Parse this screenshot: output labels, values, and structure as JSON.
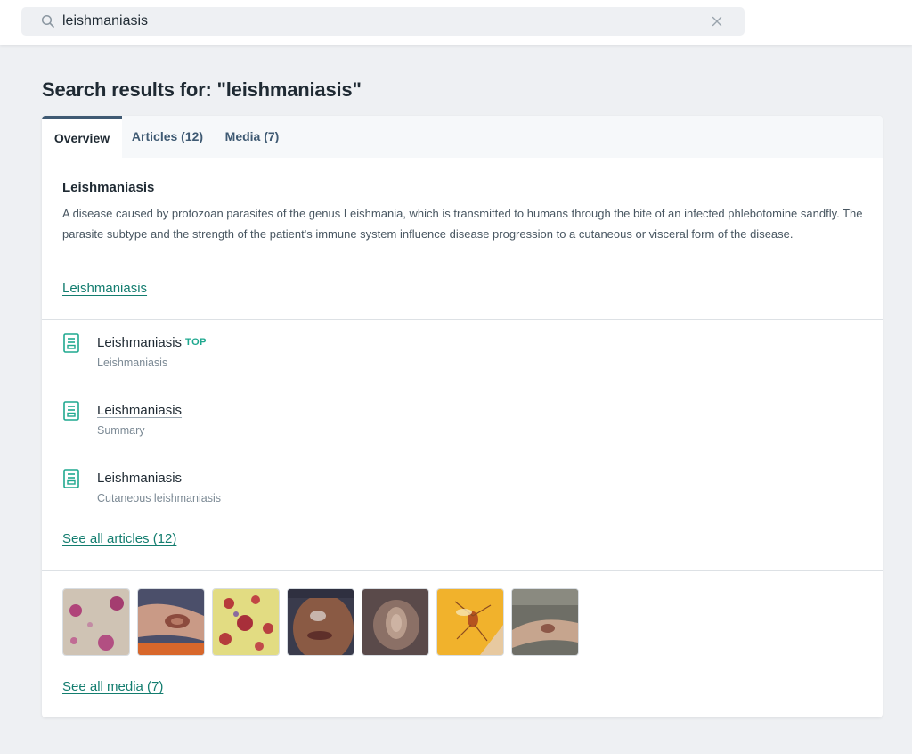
{
  "search": {
    "value": "leishmaniasis",
    "placeholder": ""
  },
  "page": {
    "title": "Search results for: \"leishmaniasis\""
  },
  "tabs": [
    {
      "label": "Overview",
      "active": true
    },
    {
      "label": "Articles (12)",
      "active": false
    },
    {
      "label": "Media (7)",
      "active": false
    }
  ],
  "definition": {
    "title": "Leishmaniasis",
    "text": "A disease caused by protozoan parasites of the genus Leishmania, which is transmitted to humans through the bite of an infected phlebotomine sandfly. The parasite subtype and the strength of the patient's immune system influence disease progression to a cutaneous or visceral form of the disease.",
    "link": "Leishmaniasis"
  },
  "articles": [
    {
      "title": "Leishmaniasis",
      "badge": "TOP",
      "subtitle": "Leishmaniasis"
    },
    {
      "title": "Leishmaniasis",
      "badge": "",
      "subtitle": "Summary"
    },
    {
      "title": "Leishmaniasis",
      "badge": "",
      "subtitle": "Cutaneous leishmaniasis"
    }
  ],
  "see_all_articles": "See all articles (12)",
  "media": {
    "thumbnail_count": 7,
    "see_all": "See all media (7)"
  },
  "colors": {
    "accent_teal": "#137d6f",
    "icon_teal": "#1fa88f",
    "tab_active_border": "#3f5a73",
    "page_background": "#eef0f3"
  },
  "icons": {
    "search": "search-icon",
    "clear": "close-icon",
    "article": "document-icon"
  }
}
